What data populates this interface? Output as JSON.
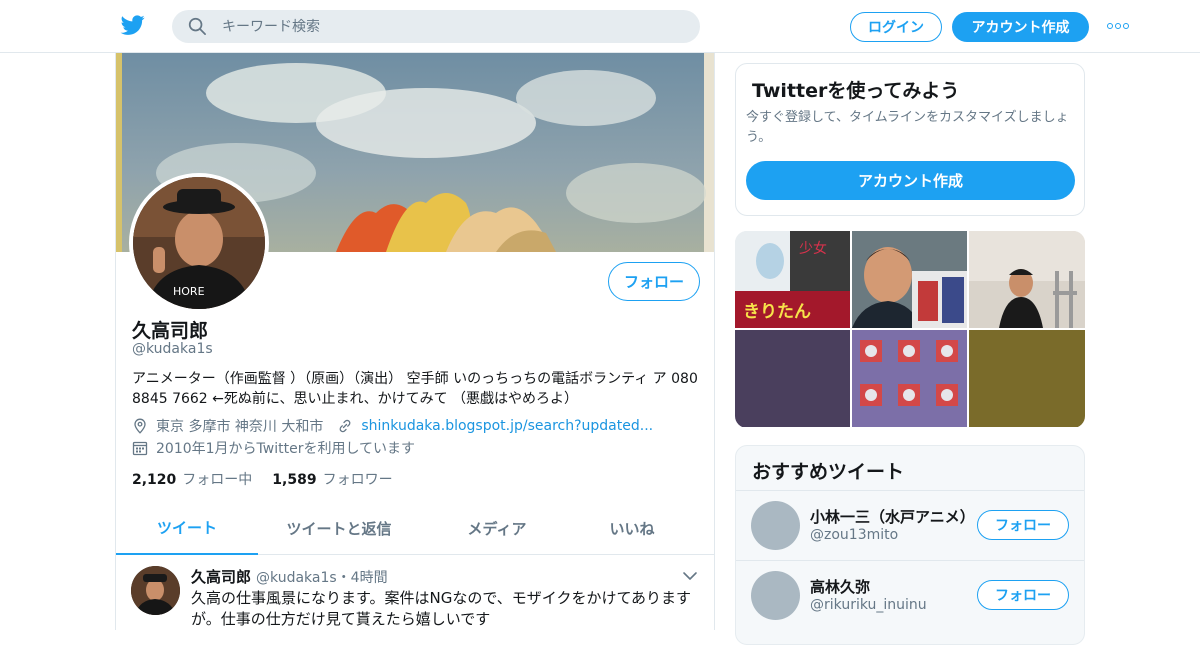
{
  "header": {
    "search_placeholder": "キーワード検索",
    "login_label": "ログイン",
    "signup_label": "アカウント作成",
    "brand_color": "#1da1f2"
  },
  "profile": {
    "name": "久高司郎",
    "handle": "@kudaka1s",
    "follow_label": "フォロー",
    "bio": "アニメーター（作画監督 ）（原画）（演出） 空手師 いのっちっちの電話ボランティ ア 080 8845 7662 ←死ぬ前に、思い止まれ、かけてみて （悪戯はやめろよ）",
    "location": "東京 多摩市 神奈川 大和市",
    "website": "shinkudaka.blogspot.jp/search?updated...",
    "joined": "2010年1月からTwitterを利用しています",
    "following_count": "2,120",
    "following_label": "フォロー中",
    "followers_count": "1,589",
    "followers_label": "フォロワー"
  },
  "tabs": [
    {
      "label": "ツイート",
      "active": true
    },
    {
      "label": "ツイートと返信",
      "active": false
    },
    {
      "label": "メディア",
      "active": false
    },
    {
      "label": "いいね",
      "active": false
    }
  ],
  "tweet": {
    "name": "久高司郎",
    "handle": "@kudaka1s",
    "time": "・4時間",
    "text": "久高の仕事風景になります。案件はNGなので、モザイクをかけてありますが。仕事の仕方だけ見て貰えたら嬉しいです"
  },
  "signup_card": {
    "title": "Twitterを使ってみよう",
    "description": "今すぐ登録して、タイムラインをカスタマイズしましょう。",
    "button_label": "アカウント作成"
  },
  "media": {
    "tile_colors": [
      "#4a3f5d",
      "#7a6b2a"
    ],
    "tile1_text": "きりたん",
    "tile1_subtext": "少女"
  },
  "recommended": {
    "title": "おすすめツイート",
    "accounts": [
      {
        "name": "小林一三（水戸アニメ）",
        "handle": "@zou13mito",
        "follow_label": "フォロー"
      },
      {
        "name": "高林久弥",
        "handle": "@rikuriku_inuinu",
        "follow_label": "フォロー"
      }
    ]
  }
}
